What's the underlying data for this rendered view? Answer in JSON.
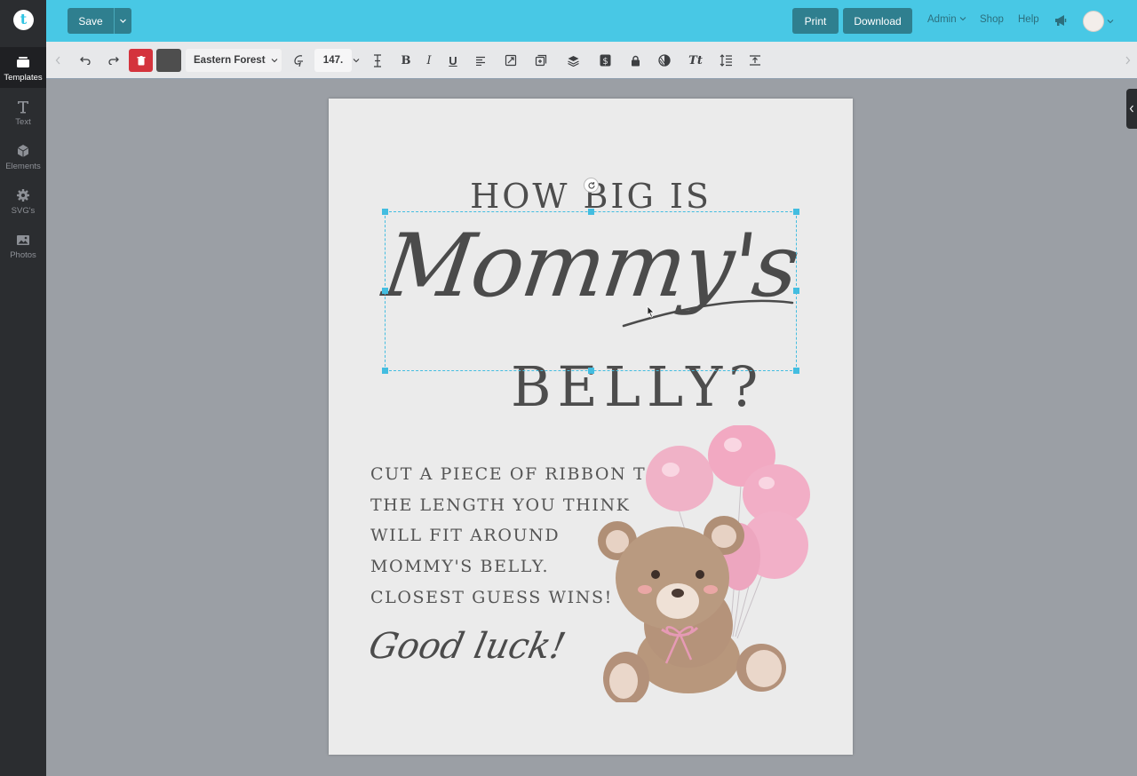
{
  "sidebar": {
    "items": [
      {
        "label": "Templates",
        "icon": "templates-icon"
      },
      {
        "label": "Text",
        "icon": "text-icon"
      },
      {
        "label": "Elements",
        "icon": "elements-icon"
      },
      {
        "label": "SVG's",
        "icon": "gear-icon"
      },
      {
        "label": "Photos",
        "icon": "photos-icon"
      }
    ],
    "logo_letter": "t"
  },
  "topbar": {
    "save_label": "Save",
    "print_label": "Print",
    "download_label": "Download",
    "admin_label": "Admin",
    "shop_label": "Shop",
    "help_label": "Help"
  },
  "toolbar": {
    "font_name": "Eastern Forest",
    "font_size": "147.",
    "color_swatch": "#4e4e4e"
  },
  "design": {
    "heading_top": "HOW BIG IS",
    "script_word": "Mommy's",
    "heading_bottom": "BELLY?",
    "instructions": [
      "CUT A PIECE OF RIBBON TO",
      "THE LENGTH YOU THINK",
      "WILL FIT AROUND",
      "MOMMY'S BELLY.",
      "CLOSEST GUESS WINS!"
    ],
    "sign_off": "Good luck!"
  },
  "colors": {
    "accent": "#48c8e5",
    "button": "#2f7f8f",
    "delete": "#d4333d",
    "selection": "#43bde0"
  }
}
